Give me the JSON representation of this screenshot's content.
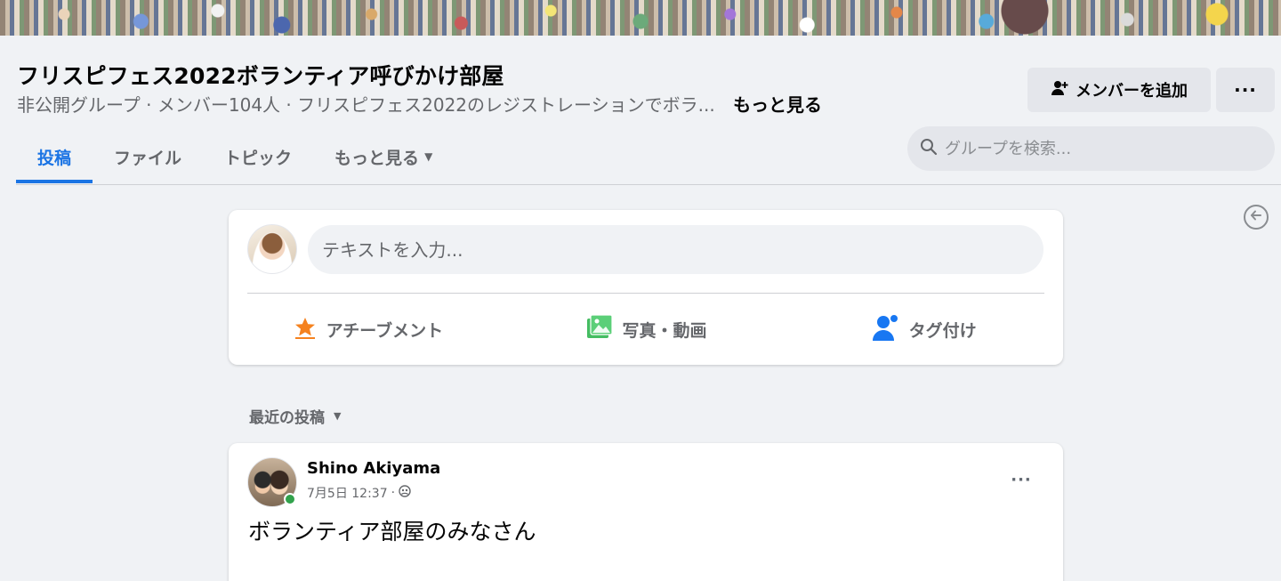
{
  "group": {
    "title": "フリスピフェス2022ボランティア呼びかけ部屋",
    "subtitle": "非公開グループ · メンバー104人 · フリスピフェス2022のレジストレーションでボラ...",
    "see_more": "もっと見る",
    "add_member_label": "メンバーを追加",
    "more_menu_label": "···"
  },
  "tabs": [
    {
      "label": "投稿",
      "active": true
    },
    {
      "label": "ファイル",
      "active": false
    },
    {
      "label": "トピック",
      "active": false
    },
    {
      "label": "もっと見る",
      "active": false
    }
  ],
  "search": {
    "placeholder": "グループを検索..."
  },
  "composer": {
    "placeholder": "テキストを入力...",
    "actions": [
      {
        "label": "アチーブメント",
        "icon": "star-icon",
        "color": "#f5821f"
      },
      {
        "label": "写真・動画",
        "icon": "photo-icon",
        "color": "#45bd62"
      },
      {
        "label": "タグ付け",
        "icon": "tag-people-icon",
        "color": "#1877f2"
      }
    ]
  },
  "sort": {
    "label": "最近の投稿"
  },
  "post": {
    "author": "Shino Akiyama",
    "timestamp": "7月5日 12:37",
    "separator": "·",
    "privacy_icon": "group-privacy-icon",
    "text": "ボランティア部屋のみなさん",
    "menu_label": "···"
  },
  "colors": {
    "accent": "#1b74e4",
    "background": "#f0f2f5",
    "online": "#31a24c"
  }
}
